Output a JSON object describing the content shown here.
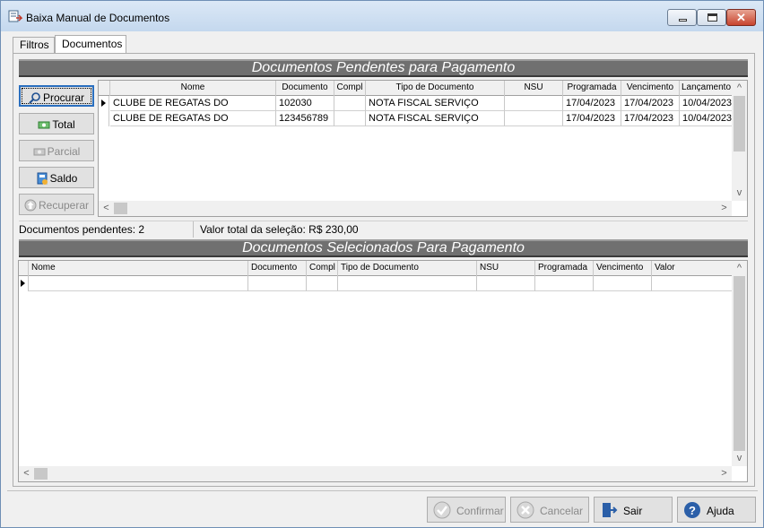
{
  "window": {
    "title": "Baixa Manual de Documentos"
  },
  "tabs": [
    {
      "label": "Filtros"
    },
    {
      "label": "Documentos"
    }
  ],
  "pending": {
    "banner": "Documentos Pendentes para Pagamento",
    "columns": [
      "Nome",
      "Documento",
      "Compl",
      "Tipo de Documento",
      "NSU",
      "Programada",
      "Vencimento",
      "Lançamento"
    ],
    "rows": [
      [
        "CLUBE DE REGATAS DO FLAMENGO",
        "102030",
        "",
        "NOTA FISCAL SERVIÇO",
        "",
        "17/04/2023",
        "17/04/2023",
        "10/04/2023"
      ],
      [
        "CLUBE DE REGATAS DO FLAMENGO",
        "123456789",
        "",
        "NOTA FISCAL SERVIÇO",
        "",
        "17/04/2023",
        "17/04/2023",
        "10/04/2023"
      ]
    ]
  },
  "side_buttons": {
    "procurar": "Procurar",
    "total": "Total",
    "parcial": "Parcial",
    "saldo": "Saldo",
    "recuperar": "Recuperar"
  },
  "status": {
    "pendentes": "Documentos pendentes: 2",
    "valor_total": "Valor total da seleção: R$ 230,00"
  },
  "selected": {
    "banner": "Documentos Selecionados Para Pagamento",
    "columns": [
      "Nome",
      "Documento",
      "Compl",
      "Tipo de Documento",
      "NSU",
      "Programada",
      "Vencimento",
      "Valor"
    ]
  },
  "footer": {
    "confirmar": "Confirmar",
    "cancelar": "Cancelar",
    "sair": "Sair",
    "ajuda": "Ajuda"
  },
  "scroll": {
    "up": "^",
    "down": "v",
    "left": "<",
    "right": ">"
  },
  "colors": {
    "banner": "#707070",
    "focus": "#2a6fbf",
    "close": "#c7442e"
  }
}
